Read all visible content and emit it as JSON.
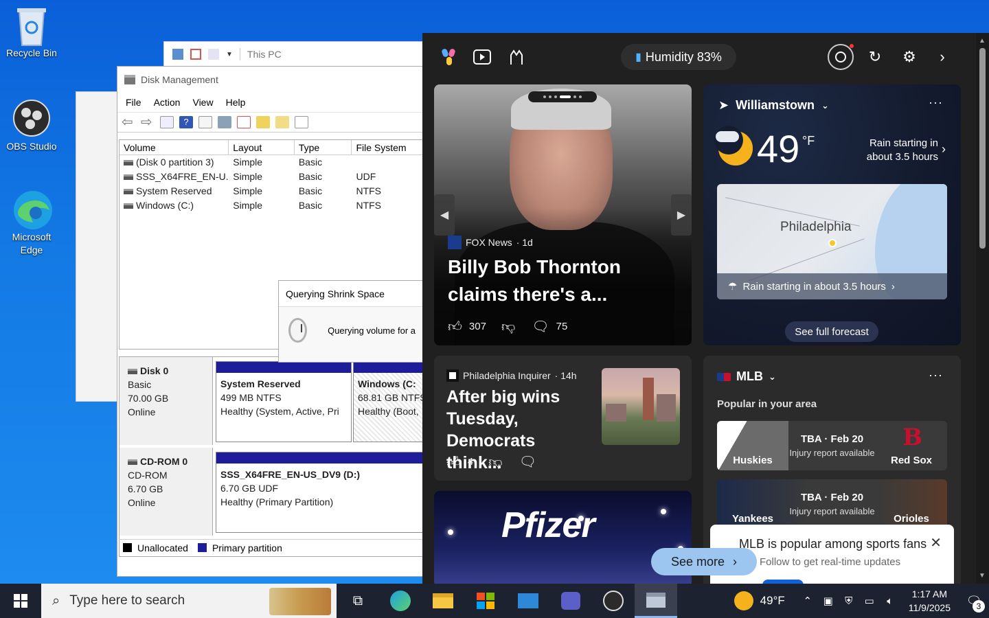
{
  "desktop": {
    "icons": [
      {
        "label": "Recycle Bin"
      },
      {
        "label": "OBS Studio"
      },
      {
        "label": "Microsoft Edge"
      }
    ]
  },
  "explorer": {
    "address": "This PC"
  },
  "disk_management": {
    "title": "Disk Management",
    "menu": [
      "File",
      "Action",
      "View",
      "Help"
    ],
    "columns": [
      "Volume",
      "Layout",
      "Type",
      "File System"
    ],
    "volumes": [
      {
        "volume": "(Disk 0 partition 3)",
        "layout": "Simple",
        "type": "Basic",
        "fs": ""
      },
      {
        "volume": "SSS_X64FRE_EN-U...",
        "layout": "Simple",
        "type": "Basic",
        "fs": "UDF"
      },
      {
        "volume": "System Reserved",
        "layout": "Simple",
        "type": "Basic",
        "fs": "NTFS"
      },
      {
        "volume": "Windows (C:)",
        "layout": "Simple",
        "type": "Basic",
        "fs": "NTFS"
      }
    ],
    "disks": [
      {
        "name": "Disk 0",
        "kind": "Basic",
        "size": "70.00 GB",
        "status": "Online",
        "partitions": [
          {
            "name": "System Reserved",
            "size": "499 MB NTFS",
            "health": "Healthy (System, Active, Pri"
          },
          {
            "name": "Windows  (C:",
            "size": "68.81 GB NTFS",
            "health": "Healthy (Boot,"
          }
        ]
      },
      {
        "name": "CD-ROM 0",
        "kind": "CD-ROM",
        "size": "6.70 GB",
        "status": "Online",
        "partitions": [
          {
            "name": "SSS_X64FRE_EN-US_DV9  (D:)",
            "size": "6.70 GB UDF",
            "health": "Healthy (Primary Partition)"
          }
        ]
      }
    ],
    "legend": [
      {
        "label": "Unallocated",
        "color": "#000000"
      },
      {
        "label": "Primary partition",
        "color": "#1d1d9c"
      }
    ]
  },
  "shrink_dialog": {
    "title": "Querying Shrink Space",
    "message": "Querying volume for a"
  },
  "widgets": {
    "humidity": "Humidity 83%",
    "hero": {
      "source": "FOX News",
      "age": "· 1d",
      "headline": "Billy Bob Thornton claims there's a...",
      "likes": "307",
      "comments": "75"
    },
    "weather": {
      "location": "Williamstown",
      "temp": "49",
      "unit": "°F",
      "rain": "Rain starting in about 3.5 hours",
      "map_city": "Philadelphia",
      "map_rain": "Rain starting in about 3.5 hours",
      "forecast_button": "See full forecast"
    },
    "news2": {
      "source": "Philadelphia Inquirer",
      "age": "· 14h",
      "headline": "After big wins Tuesday, Democrats think...",
      "likes": "4"
    },
    "news3": {
      "logo_text": "Pfizer"
    },
    "mlb": {
      "title": "MLB",
      "subtitle": "Popular in your area",
      "games": [
        {
          "home": "Huskies",
          "away": "Red Sox",
          "time": "TBA · Feb 20",
          "status": "Injury report available"
        },
        {
          "home": "Yankees",
          "away": "Orioles",
          "time": "TBA · Feb 20",
          "status": "Injury report available"
        }
      ],
      "popup_title": "MLB is popular among sports fans",
      "popup_sub": "Follow to get real-time updates"
    },
    "see_more": "See more"
  },
  "taskbar": {
    "search_placeholder": "Type here to search",
    "weather_temp": "49°F",
    "time": "1:17 AM",
    "date": "11/9/2025",
    "notifications": "3"
  }
}
